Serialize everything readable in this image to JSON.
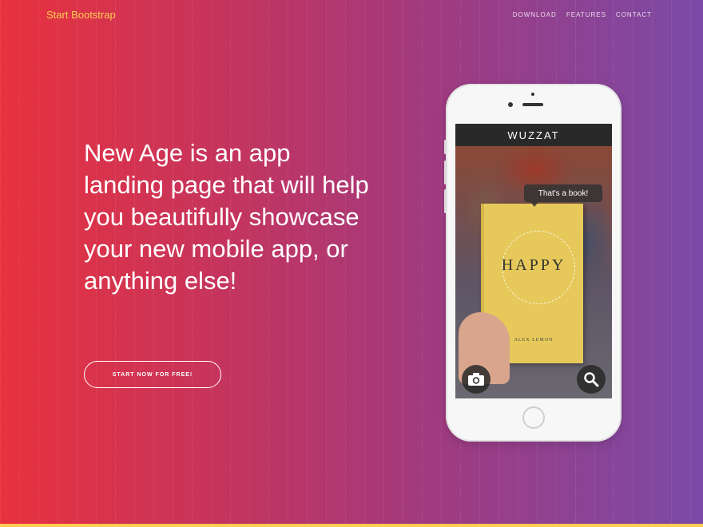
{
  "navbar": {
    "brand": "Start Bootstrap",
    "links": [
      {
        "label": "DOWNLOAD"
      },
      {
        "label": "FEATURES"
      },
      {
        "label": "CONTACT"
      }
    ]
  },
  "hero": {
    "headline": "New Age is an app landing page that will help you beautifully showcase your new mobile app, or anything else!",
    "cta_label": "START NOW FOR FREE!"
  },
  "phone": {
    "app_title": "WUZZAT",
    "tooltip": "That's a book!",
    "book_title": "HAPPY",
    "book_author": "ALEX LEMON",
    "icons": {
      "left": "camera-icon",
      "right": "search-icon"
    }
  },
  "colors": {
    "brand": "#fdcc52",
    "gradient_start": "#e8323e",
    "gradient_end": "#7b4aa6",
    "accent_bar": "#fdcc52"
  }
}
